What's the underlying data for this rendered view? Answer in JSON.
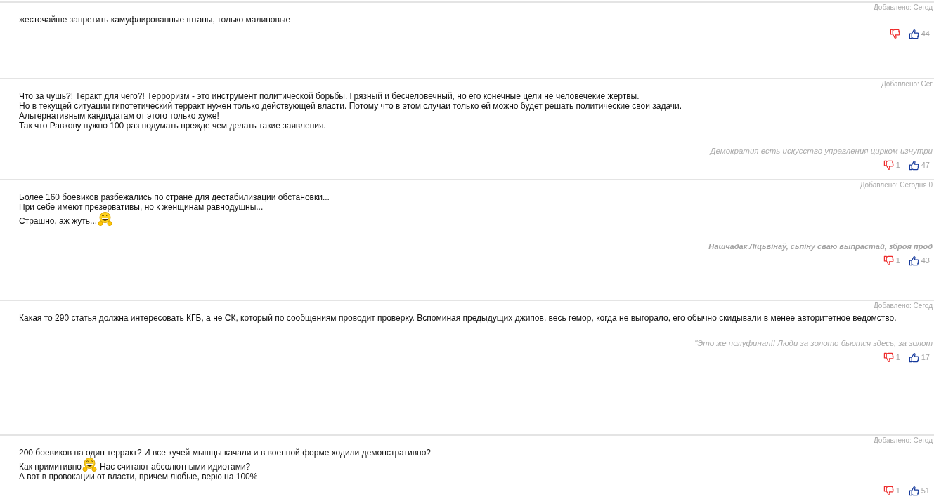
{
  "comments": [
    {
      "added": "Добавлено: Сегод",
      "lines": [
        [
          {
            "kind": "text",
            "text": "жесточайше запретить камуфлированные штаны, только малиновые"
          }
        ]
      ],
      "votes": {
        "likes": "44"
      }
    },
    {
      "added": "Добавлено: Сег",
      "lines": [
        [
          {
            "kind": "text",
            "text": "Что за чушь?! Теракт для чего?! Терроризм - это инструмент политической борьбы. Грязный и бесчеловечный, но его конечные цели не человечекие жертвы."
          }
        ],
        [
          {
            "kind": "text",
            "text": "Но в текущей ситуации гипотетический терракт нужен только действующей власти. Потому что в этом случаи только ей можно будет решать политические свои задачи."
          }
        ],
        [
          {
            "kind": "text",
            "text": "Альтернативным кандидатам от этого только хуже!"
          }
        ],
        [
          {
            "kind": "text",
            "text": "Так что Равкову нужно 100 раз подумать прежде чем делать такие заявления."
          }
        ]
      ],
      "signature": {
        "text": "Демократия есть искусство управления цирком изнутри",
        "bold": false
      },
      "votes": {
        "dislikes": "1",
        "likes": "47"
      }
    },
    {
      "added": "Добавлено: Сегодня 0",
      "lines": [
        [
          {
            "kind": "text",
            "text": "Более 160 боевиков разбежались по стране для дестабилизации обстановки..."
          }
        ],
        [
          {
            "kind": "text",
            "text": "При себе имеют презервативы, но к женщинам равнодушны..."
          }
        ],
        [
          {
            "kind": "text",
            "text": "Страшно, аж жуть..."
          },
          {
            "kind": "emoji"
          }
        ]
      ],
      "signature": {
        "text": "Нашчадак Ліцьвінаў, сьпіну сваю выпрастай, зброя прод",
        "bold": true
      },
      "votes": {
        "dislikes": "1",
        "likes": "43"
      }
    },
    {
      "added": "Добавлено: Сегод",
      "lines": [
        [
          {
            "kind": "text",
            "text": "Какая то 290 статья должна интересовать КГБ, а не СК, который по сообщениям проводит проверку. Вспоминая предыдущих джипов, весь гемор, когда не выгорало, его обычно скидывали в менее авторитетное ведомство."
          }
        ]
      ],
      "signature": {
        "text": "\"Это же полуфинал!! Люди за золото бьются здесь, за золот",
        "bold": false
      },
      "votes": {
        "dislikes": "1",
        "likes": "17"
      }
    },
    {
      "added": "Добавлено: Сегод",
      "lines": [
        [
          {
            "kind": "text",
            "text": "200 боевиков на один терракт? И все кучей мышцы качали и в военной форме ходили демонстративно?"
          }
        ],
        [
          {
            "kind": "text",
            "text": "Как примитивно"
          },
          {
            "kind": "emoji"
          },
          {
            "kind": "text",
            "text": "Нас считают абсолютными идиотами?"
          }
        ],
        [
          {
            "kind": "text",
            "text": "А вот в провокации от власти, причем любые, верю на 100%"
          }
        ]
      ],
      "votes": {
        "dislikes": "1",
        "likes": "51"
      }
    }
  ]
}
